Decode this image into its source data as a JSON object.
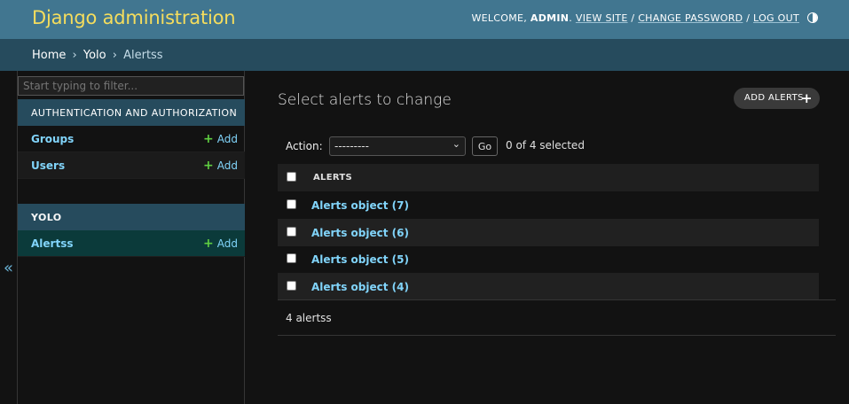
{
  "header": {
    "site_name": "Django administration",
    "welcome": "WELCOME,",
    "username": "ADMIN",
    "view_site": "VIEW SITE",
    "change_password": "CHANGE PASSWORD",
    "log_out": "LOG OUT",
    "separator": "/",
    "theme_icon": "half-circle-icon"
  },
  "breadcrumbs": {
    "items": [
      "Home",
      "Yolo",
      "Alertss"
    ],
    "separator": "›"
  },
  "sidebar": {
    "collapse_glyph": "«",
    "filter_placeholder": "Start typing to filter...",
    "modules": [
      {
        "caption": "AUTHENTICATION AND AUTHORIZATION",
        "models": [
          {
            "name": "Groups",
            "add": "Add"
          },
          {
            "name": "Users",
            "add": "Add"
          }
        ]
      },
      {
        "caption": "YOLO",
        "models": [
          {
            "name": "Alertss",
            "add": "Add",
            "current": true
          }
        ]
      }
    ]
  },
  "content": {
    "title": "Select alerts to change",
    "add_button": "ADD ALERTS",
    "action_label": "Action:",
    "action_selected": "---------",
    "go_label": "Go",
    "selected_count": "0 of 4 selected",
    "column_header": "ALERTS",
    "rows": [
      "Alerts object (7)",
      "Alerts object (6)",
      "Alerts object (5)",
      "Alerts object (4)"
    ],
    "paginator": "4 alertss"
  },
  "colors": {
    "header_bg": "#417690",
    "breadcrumbs_bg": "#264b5d",
    "site_name": "#f5dd5d",
    "link": "#81d4fa",
    "add_plus": "#5fce41",
    "current_model_bg": "#0b3a3a"
  }
}
